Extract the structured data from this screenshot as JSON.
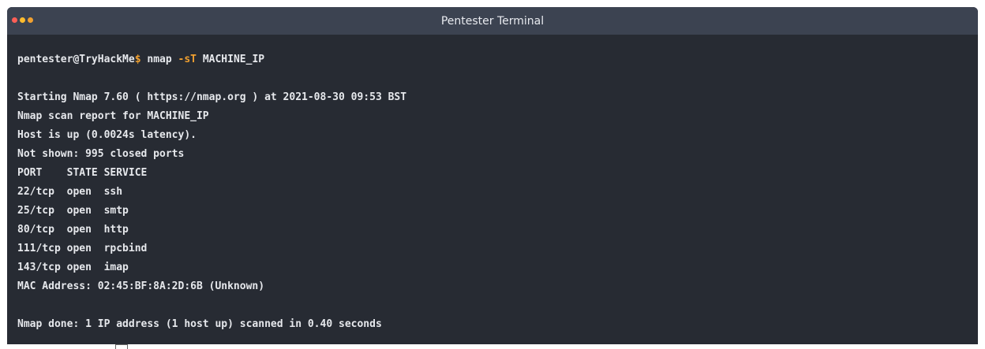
{
  "window": {
    "title": "Pentester Terminal"
  },
  "prompt": {
    "user_host": "pentester@TryHackMe",
    "symbol": "$",
    "command": "nmap",
    "flag": "-sT",
    "target": "MACHINE_IP"
  },
  "output": {
    "lines": [
      "Starting Nmap 7.60 ( https://nmap.org ) at 2021-08-30 09:53 BST",
      "Nmap scan report for MACHINE_IP",
      "Host is up (0.0024s latency).",
      "Not shown: 995 closed ports",
      "PORT    STATE SERVICE",
      "22/tcp  open  ssh",
      "25/tcp  open  smtp",
      "80/tcp  open  http",
      "111/tcp open  rpcbind",
      "143/tcp open  imap",
      "MAC Address: 02:45:BF:8A:2D:6B (Unknown)"
    ],
    "done": "Nmap done: 1 IP address (1 host up) scanned in 0.40 seconds"
  },
  "colors": {
    "terminal_bg": "#272b33",
    "titlebar_bg": "#3c4351",
    "accent": "#f0a030",
    "text": "#e6e8ec"
  }
}
